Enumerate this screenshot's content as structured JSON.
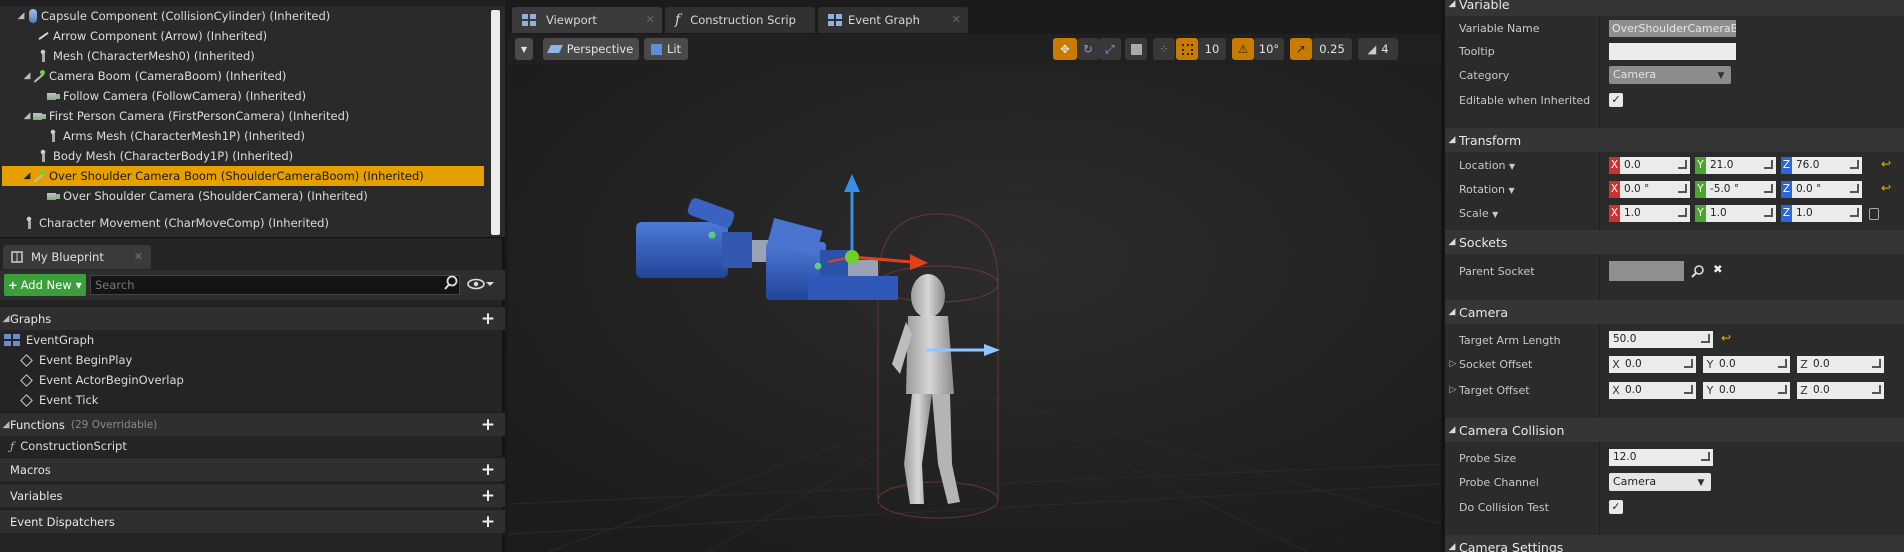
{
  "components": {
    "items": [
      {
        "label": "Capsule Component (CollisionCylinder) (Inherited)",
        "expand": "◢",
        "icon": "capsule-icon"
      },
      {
        "label": "Arrow Component (Arrow) (Inherited)",
        "expand": "",
        "icon": "arrow-component-icon"
      },
      {
        "label": "Mesh (CharacterMesh0) (Inherited)",
        "expand": "",
        "icon": "mesh-icon"
      },
      {
        "label": "Camera Boom (CameraBoom) (Inherited)",
        "expand": "◢",
        "icon": "spring-arm-icon"
      },
      {
        "label": "Follow Camera (FollowCamera) (Inherited)",
        "expand": "",
        "icon": "camera-icon"
      },
      {
        "label": "First Person Camera (FirstPersonCamera) (Inherited)",
        "expand": "◢",
        "icon": "camera-icon"
      },
      {
        "label": "Arms Mesh (CharacterMesh1P) (Inherited)",
        "expand": "",
        "icon": "mesh-icon"
      },
      {
        "label": "Body Mesh (CharacterBody1P) (Inherited)",
        "expand": "",
        "icon": "mesh-icon"
      },
      {
        "label": "Over Shoulder Camera Boom (ShoulderCameraBoom) (Inherited)",
        "expand": "◢",
        "icon": "spring-arm-icon"
      },
      {
        "label": "Over Shoulder Camera (ShoulderCamera) (Inherited)",
        "expand": "",
        "icon": "camera-icon"
      },
      {
        "label": "Character Movement (CharMoveComp) (Inherited)",
        "expand": "",
        "icon": "movement-icon"
      }
    ]
  },
  "my_blueprint": {
    "tab_label": "My Blueprint",
    "add_new_label": "Add New",
    "search_placeholder": "Search",
    "graphs": {
      "label": "Graphs",
      "items": [
        "EventGraph",
        "Event BeginPlay",
        "Event ActorBeginOverlap",
        "Event Tick"
      ]
    },
    "functions": {
      "label": "Functions",
      "overridable": "(29 Overridable)",
      "items": [
        "ConstructionScript"
      ]
    },
    "macros": "Macros",
    "variables": "Variables",
    "dispatchers": "Event Dispatchers"
  },
  "viewport": {
    "tabs": [
      "Viewport",
      "Construction Scrip",
      "Event Graph"
    ],
    "perspective": "Perspective",
    "lit": "Lit",
    "grid_snap": "10",
    "rot_snap": "10°",
    "scale_snap": "0.25",
    "cam_speed": "4",
    "colors": {
      "accent": "#c97b00",
      "x_axis": "#e0401a",
      "y_axis": "#3a8ee6",
      "mesh_blue": "#2f58b8"
    }
  },
  "details": {
    "variable_section": "Variable",
    "variable_name_label": "Variable Name",
    "variable_name_value": "OverShoulderCameraBo",
    "tooltip_label": "Tooltip",
    "category_label": "Category",
    "category_value": "Camera",
    "editable_label": "Editable when Inherited",
    "transform_section": "Transform",
    "location_label": "Location",
    "location": [
      "0.0",
      "21.0",
      "76.0"
    ],
    "rotation_label": "Rotation",
    "rotation": [
      "0.0 °",
      "-5.0 °",
      "0.0 °"
    ],
    "scale_label": "Scale",
    "scale": [
      "1.0",
      "1.0",
      "1.0"
    ],
    "sockets_section": "Sockets",
    "parent_socket_label": "Parent Socket",
    "camera_section": "Camera",
    "target_arm_label": "Target Arm Length",
    "target_arm_value": "50.0",
    "socket_offset_label": "Socket Offset",
    "socket_offset": [
      "0.0",
      "0.0",
      "0.0"
    ],
    "target_offset_label": "Target Offset",
    "target_offset": [
      "0.0",
      "0.0",
      "0.0"
    ],
    "collision_section": "Camera Collision",
    "probe_size_label": "Probe Size",
    "probe_size_value": "12.0",
    "probe_channel_label": "Probe Channel",
    "probe_channel_value": "Camera",
    "do_collision_label": "Do Collision Test",
    "settings_section": "Camera Settings",
    "axis_x": "X",
    "axis_y": "Y",
    "axis_z": "Z",
    "check": "✓"
  }
}
